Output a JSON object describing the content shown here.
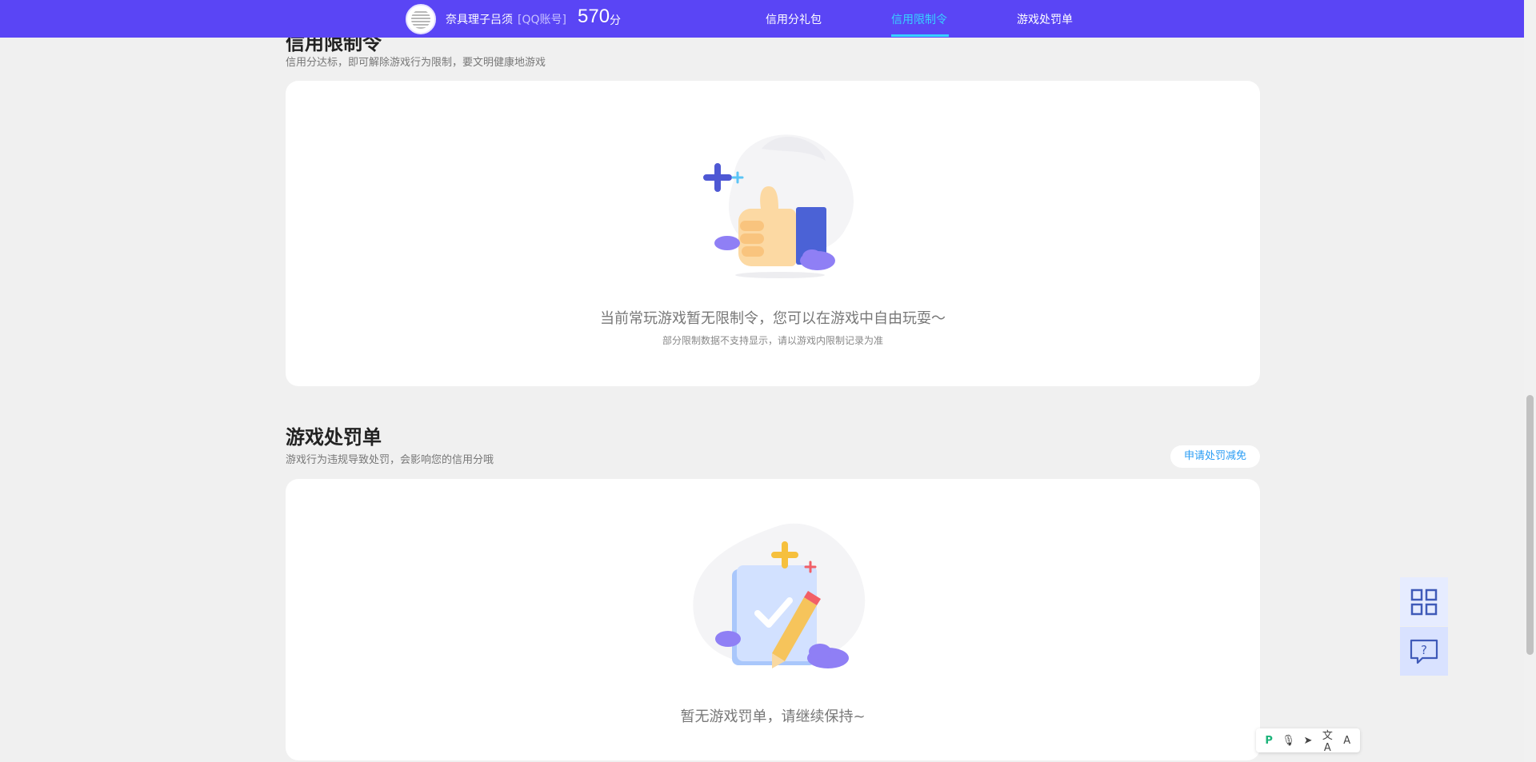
{
  "header": {
    "username": "奈具理子吕须",
    "account_type": "[QQ账号]",
    "score": "570",
    "score_unit": "分",
    "tabs": [
      {
        "label": "信用分礼包",
        "active": false
      },
      {
        "label": "信用限制令",
        "active": true
      },
      {
        "label": "游戏处罚单",
        "active": false
      }
    ],
    "colors": {
      "bar": "#5a45f5",
      "active_tab": "#36d2ff"
    }
  },
  "restriction_section": {
    "title": "信用限制令",
    "subtitle": "信用分达标，即可解除游戏行为限制，要文明健康地游戏",
    "empty_main": "当前常玩游戏暂无限制令，您可以在游戏中自由玩耍～",
    "empty_sub": "部分限制数据不支持显示，请以游戏内限制记录为准",
    "illustration_icon": "thumbs-up-icon"
  },
  "penalty_section": {
    "title": "游戏处罚单",
    "subtitle": "游戏行为违规导致处罚，会影响您的信用分哦",
    "action_button": "申请处罚减免",
    "empty_main": "暂无游戏罚单，请继续保持~",
    "illustration_icon": "checklist-pencil-icon"
  },
  "floating_buttons": [
    {
      "icon": "qr-code-icon"
    },
    {
      "icon": "help-chat-icon"
    }
  ],
  "mini_toolbar": {
    "items": [
      "P",
      "🎙",
      "➤",
      "文A",
      "A"
    ]
  }
}
